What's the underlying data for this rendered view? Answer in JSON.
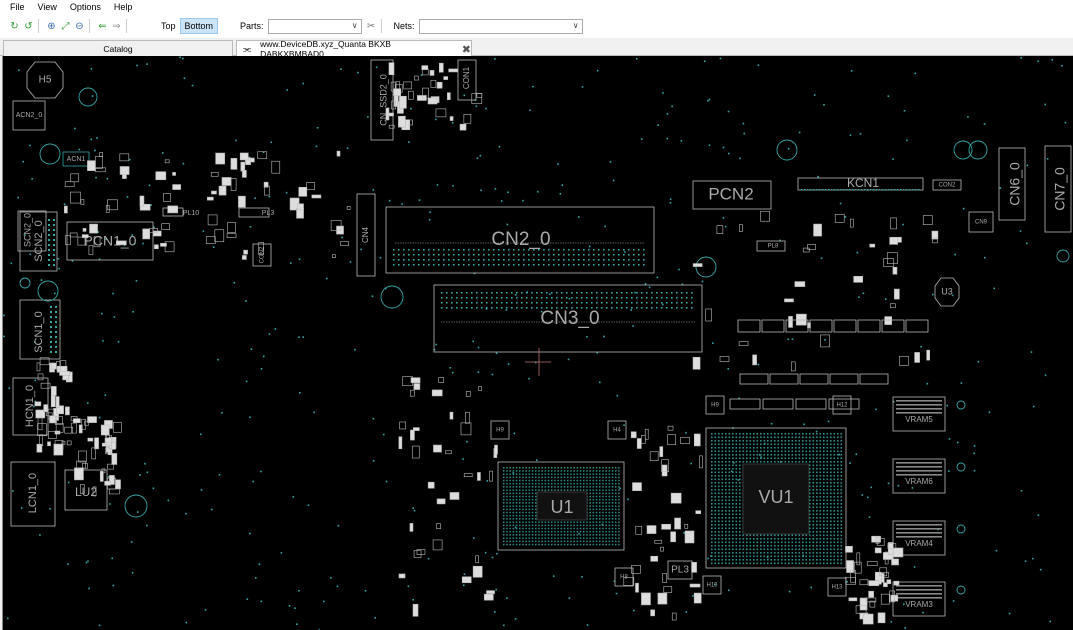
{
  "menu": [
    "File",
    "View",
    "Options",
    "Help"
  ],
  "toolbar": {
    "icons": [
      "refresh-cw-icon",
      "refresh-ccw-icon",
      "zoom-in-icon",
      "fit-icon",
      "zoom-out-icon",
      "back-icon",
      "forward-icon"
    ],
    "side_top": "Top",
    "side_bottom": "Bottom",
    "parts_label": "Parts:",
    "parts_value": "",
    "nets_label": "Nets:",
    "nets_value": ""
  },
  "tabs": {
    "catalog": "Catalog",
    "board": "www.DeviceDB.xyz_Quanta BKXB DABKXBMBAD0"
  },
  "board": {
    "colors": {
      "background": "#000000",
      "outline": "#b8b8b8",
      "pad": "#35a7a7",
      "label": "#aaaaaa"
    },
    "large_labels": [
      "CN2_0",
      "CN3_0",
      "U1",
      "VU1",
      "PCN1_0",
      "PCN2",
      "KCN1",
      "CN6_0",
      "CN7_0"
    ],
    "side_labels": [
      "SCN2_0",
      "SCN1_0",
      "HCN1_0",
      "LCN1_0",
      "CN_SSD2_0",
      "CN4"
    ],
    "small_labels": [
      "H5",
      "ACN2_0",
      "ACN1",
      "LU2",
      "CON1",
      "PL10",
      "PL3",
      "PL8",
      "U3",
      "H4",
      "H9",
      "H11",
      "H12",
      "H13",
      "H8",
      "H10",
      "VRAM5",
      "VRAM6",
      "VRAM4",
      "VRAM3",
      "CN9",
      "CN8",
      "CON2"
    ]
  }
}
